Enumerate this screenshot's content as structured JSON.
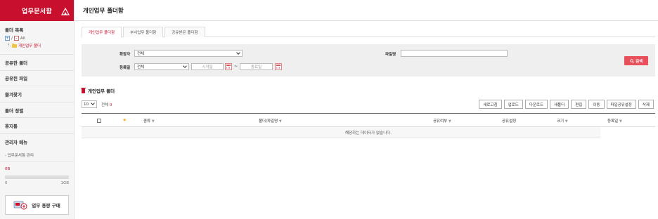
{
  "sidebar": {
    "brand_title": "업무문서함",
    "folder_list_title": "폴더 목록",
    "tree_expand": "+",
    "tree_collapse": "-",
    "tree_sep": "/",
    "tree_all": "All",
    "tree_item": "개인업무 폴더",
    "menu": [
      {
        "label": "공유한 폴더"
      },
      {
        "label": "공유된 파일"
      },
      {
        "label": "즐겨찾기"
      },
      {
        "label": "폴더 정렬"
      },
      {
        "label": "휴지통"
      },
      {
        "label": "관리자 메뉴"
      }
    ],
    "admin_sub": "- 업무문서함 관리",
    "quota": {
      "used": "0B",
      "min": "0",
      "max": "1GB",
      "fill_fraction": 0
    },
    "buy_button": "업무 용량 구매"
  },
  "main": {
    "page_title": "개인업무 폴더함",
    "tabs": [
      {
        "label": "개인업무 폴더함",
        "active": true
      },
      {
        "label": "부서업무 폴더함",
        "active": false
      },
      {
        "label": "공유받은 폴더함",
        "active": false
      }
    ],
    "search": {
      "extension_label": "확장자",
      "extension_value": "전체",
      "filename_label": "파일명",
      "filename_value": "",
      "regdate_label": "등록일",
      "regdate_value": "전체",
      "start_placeholder": "시작일",
      "end_placeholder": "종료일",
      "range_sep": "~",
      "button": "검색"
    },
    "section_title": "개인업무 폴더",
    "page_size": "10",
    "total_label": "전체",
    "total_count": "0",
    "toolbar_buttons": [
      "새로고침",
      "업로드",
      "다운로드",
      "새폴더",
      "편집",
      "이동",
      "파일공유설정",
      "삭제"
    ],
    "columns": {
      "star": "★",
      "type": "종류",
      "name": "폴더/파일명",
      "shared": "공유여부",
      "share_setting": "공유설정",
      "size": "크기",
      "regdate": "등록일",
      "sort_mark": "▼"
    },
    "empty_message": "해당하는 데이터가 없습니다."
  },
  "colors": {
    "brand": "#c8102e",
    "search_button": "#e8505b"
  }
}
